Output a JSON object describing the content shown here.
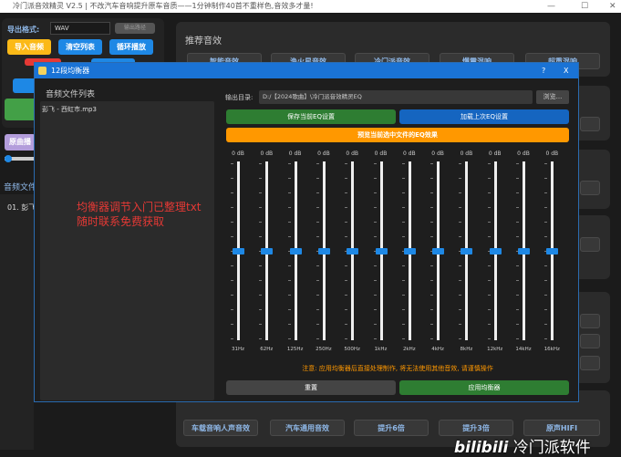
{
  "window": {
    "title": "冷门派音效精灵 V2.5 | 不改汽车音响提升原车音质——1分钟制作40首不重样色,音效多才量!",
    "minimize": "—",
    "maximize": "☐",
    "close": "✕"
  },
  "left": {
    "format_label": "导出格式:",
    "format_value": "WAV",
    "export_path_btn": "输出路径",
    "import_btn": "导入音频",
    "clear_btn": "清空列表",
    "loop_btn": "循环播放",
    "purple_btn": "原曲播",
    "list_title": "音频文件",
    "list_item": "01. 彭飞"
  },
  "right": {
    "recommend_title": "推荐音效",
    "recommend_buttons": [
      "智能音效",
      "渔火星音效",
      "冷门派音效",
      "爆震混响",
      "超重混响"
    ],
    "bottom_buttons": [
      "车载音响人声音效",
      "汽车通用音效",
      "提升6倍",
      "提升3倍",
      "原声HIFI"
    ]
  },
  "dialog": {
    "title": "12段均衡器",
    "help": "?",
    "close": "X",
    "file_list_title": "音频文件列表",
    "files": [
      "彭飞 - 西虹市.mp3"
    ],
    "output_label": "输出目录:",
    "output_path": "D:/【2024歌曲】\\冷门派音效精灵EQ",
    "browse": "浏览...",
    "save_btn": "保存当前EQ设置",
    "load_btn": "加载上次EQ设置",
    "preview_btn": "预览当前选中文件的EQ效果",
    "bands": [
      {
        "freq": "31Hz",
        "gain": "0 dB"
      },
      {
        "freq": "62Hz",
        "gain": "0 dB"
      },
      {
        "freq": "125Hz",
        "gain": "0 dB"
      },
      {
        "freq": "250Hz",
        "gain": "0 dB"
      },
      {
        "freq": "500Hz",
        "gain": "0 dB"
      },
      {
        "freq": "1kHz",
        "gain": "0 dB"
      },
      {
        "freq": "2kHz",
        "gain": "0 dB"
      },
      {
        "freq": "4kHz",
        "gain": "0 dB"
      },
      {
        "freq": "8kHz",
        "gain": "0 dB"
      },
      {
        "freq": "12kHz",
        "gain": "0 dB"
      },
      {
        "freq": "14kHz",
        "gain": "0 dB"
      },
      {
        "freq": "16kHz",
        "gain": "0 dB"
      }
    ],
    "warning": "注意: 应用均衡器后直接处理制作, 将无法使用其他音效, 请谨慎操作",
    "reset_btn": "重置",
    "apply_btn": "应用均衡器"
  },
  "overlay": {
    "line1": "均衡器调节入门已整理txt",
    "line2": "随时联系免费获取"
  },
  "watermark": {
    "logo": "bilibili",
    "text": "冷门派软件"
  },
  "colors": {
    "accent": "#1a73d6",
    "green": "#2e7d32",
    "orange": "#ff9800",
    "red_text": "#e53935"
  }
}
